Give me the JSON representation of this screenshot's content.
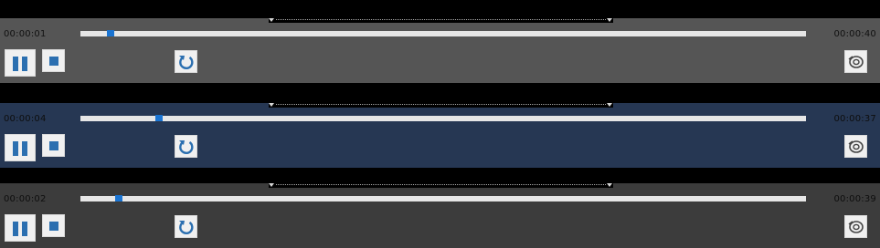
{
  "players": [
    {
      "elapsed": "00:00:01",
      "remaining": "00:00:40",
      "progress": 0.042,
      "state": "playing",
      "selected": false
    },
    {
      "elapsed": "00:00:04",
      "remaining": "00:00:37",
      "progress": 0.108,
      "state": "playing",
      "selected": true
    },
    {
      "elapsed": "00:00:02",
      "remaining": "00:00:39",
      "progress": 0.053,
      "state": "playing",
      "selected": false
    }
  ],
  "icons": {
    "pause": "pause-icon",
    "stop": "stop-icon",
    "loop": "loop-icon",
    "snapshot": "snapshot-icon"
  },
  "colors": {
    "accent": "#1a74d2",
    "icon": "#2b6fb0",
    "selected_row": "#263753"
  }
}
